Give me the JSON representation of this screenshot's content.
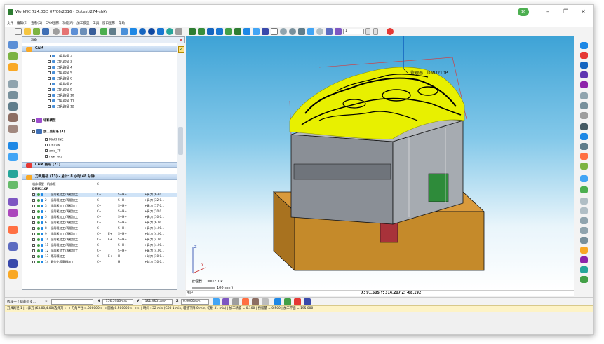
{
  "window": {
    "title": "WorkNC 724.03D  07/06/2016 - D:/test/274-shk\\",
    "badge": "16",
    "min": "–",
    "max": "❐",
    "close": "✕"
  },
  "menu": [
    "文件",
    "编辑(E)",
    "查看(D)",
    "CAM图形",
    "功能(F)",
    "加工模型",
    "工具",
    "窗口图形",
    "帮助"
  ],
  "toolbar": {
    "value_field": "1"
  },
  "panel": {
    "header_label": "准备",
    "sections": {
      "cam": "CAM",
      "stock": "坯料模型",
      "coord": "加工坐标系 (4)",
      "cam_graphics": "CAM 图形 (21)",
      "toolpaths": "刀具路径 (13) - 总计: 8 小时 48 分钟"
    },
    "path_items": [
      "刀具路径 2",
      "刀具路径 3",
      "刀具路径 4",
      "刀具路径 5",
      "刀具路径 6",
      "刀具路径 8",
      "刀具路径 9",
      "刀具路径 10",
      "刀具路径 11",
      "刀具路径 12"
    ],
    "coord_items": [
      "MACHINE",
      "ORIGIN",
      "axis_78",
      "new_ucs"
    ],
    "machine_row": {
      "label": "机床模型 - 机床框",
      "value": "C+"
    },
    "machine_name": "DMU210P",
    "toolpaths": [
      {
        "num": "1",
        "name": "全局粗加工/再粗加工",
        "c1": "C+",
        "c2": "",
        "c3": "S+H+",
        "tool": "+鼻刀 (63.0..."
      },
      {
        "num": "2",
        "name": "全局粗加工/再粗加工",
        "c1": "C+",
        "c2": "",
        "c3": "S+H+",
        "tool": "+鼻刀 (32.0..."
      },
      {
        "num": "3",
        "name": "全局粗加工/再粗加工",
        "c1": "C+",
        "c2": "",
        "c3": "S+H+",
        "tool": "+鼻刀 (17.0..."
      },
      {
        "num": "4",
        "name": "全局粗加工/再粗加工",
        "c1": "C+",
        "c2": "",
        "c3": "S+H+",
        "tool": "+鼻刀 (10.0..."
      },
      {
        "num": "5",
        "name": "全局粗加工/再粗加工",
        "c1": "C+",
        "c2": "",
        "c3": "S+H+",
        "tool": "+鼻刀 (10.0..."
      },
      {
        "num": "6",
        "name": "全局粗加工/再粗加工",
        "c1": "C+",
        "c2": "",
        "c3": "S+H+",
        "tool": "+鼻刀 (6.00..."
      },
      {
        "num": "8",
        "name": "全局粗加工/再粗加工",
        "c1": "C+",
        "c2": "",
        "c3": "S+H+",
        "tool": "+鼻刀 (4.00..."
      },
      {
        "num": "9",
        "name": "全局粗加工/再粗加工",
        "c1": "C+",
        "c2": "E+",
        "c3": "S+H+",
        "tool": "+球刀 (4.00..."
      },
      {
        "num": "10",
        "name": "全局粗加工/再粗加工",
        "c1": "C+",
        "c2": "E+",
        "c3": "S+H+",
        "tool": "+鼻刀 (4.00..."
      },
      {
        "num": "11",
        "name": "全局粗加工/再粗加工",
        "c1": "C+",
        "c2": "",
        "c3": "S+H+",
        "tool": "+鼻刀 (4.00..."
      },
      {
        "num": "12",
        "name": "全局粗加工/再粗加工",
        "c1": "C+",
        "c2": "",
        "c3": "S+H+",
        "tool": "+鼻刀 (4.00..."
      },
      {
        "num": "13",
        "name": "等高精加工",
        "c1": "C+",
        "c2": "E+",
        "c3": "H",
        "tool": "+球刀 (10.0..."
      },
      {
        "num": "14",
        "name": "最佳化等高精加工",
        "c1": "C+",
        "c2": "",
        "c3": "H",
        "tool": "+球刀 (10.0..."
      }
    ]
  },
  "viewport": {
    "machine_label_top": "管理器：DMU210P",
    "machine_label_bottom": "管理器：DMU210P",
    "scale": "100(mm)",
    "axis_x": "X",
    "axis_z": "Z",
    "coords": "X:  91.505   Y:  314.207   Z:  -68.192",
    "user": "用户"
  },
  "bottom": {
    "prompt": "选择一个新的指令...",
    "x_label": "X",
    "x_value": "-136.3988mm",
    "y_label": "Y",
    "y_value": "-151.9531mm",
    "z_label": "Z",
    "z_value": "0.0000mm"
  },
  "status": "刀具路径 1 | <鼻刀 (63.00,4.00)选择刀 > < 刀角半径:4.000000 > < 圆角:0.500000 > < > | 时间 : 32 min (G00 1 min, 增速下降 0 min, 切削 31 min) | 加工精度 = 0.100 | 预留量 = 0.500 | 加工平面 = 195.000",
  "colors": {
    "toolpath": "#e8f000",
    "part": "#8a8f96",
    "base": "#c58a2a",
    "clamp": "#a8323a",
    "accent_green": "#2e8b3a"
  }
}
